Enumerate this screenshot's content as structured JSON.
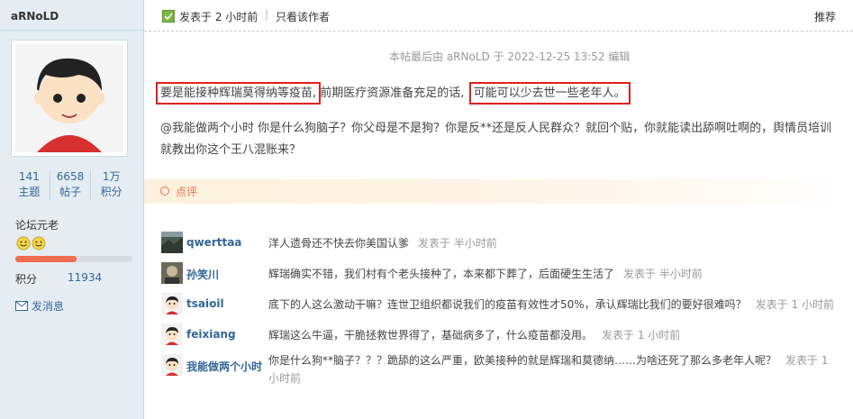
{
  "author": {
    "username": "aRNoLD",
    "stats": [
      {
        "value": "141",
        "label": "主题"
      },
      {
        "value": "6658",
        "label": "帖子"
      },
      {
        "value": "1万",
        "label": "积分"
      }
    ],
    "rank": "论坛元老",
    "progress": 0.52,
    "credits_label": "积分",
    "credits_value": "11934",
    "message_label": "发消息"
  },
  "post": {
    "posted_time": "发表于 2 小时前",
    "separator": "|",
    "only_author": "只看该作者",
    "recommend": "推荐",
    "edited_note": "本帖最后由 aRNoLD 于 2022-12-25 13:52 编辑",
    "para1_part1": "要是能接种辉瑞莫得纳等疫苗,",
    "para1_part2": "前期医疗资源准备充足的话,",
    "para1_part3": "可能可以少去世一些老年人。",
    "para2": "@我能做两个小时 你是什么狗脑子？你父母是不是狗？你是反**还是反人民群众？就回个贴，你就能读出舔啊吐啊的，舆情员培训就教出你这个王八混账来？"
  },
  "rating": {
    "label": "点评"
  },
  "comments": [
    {
      "user": "qwerttaa",
      "text": "洋人遗骨还不快去你美国认爹",
      "time": "发表于 半小时前"
    },
    {
      "user": "孙笑川",
      "text": "辉瑞确实不错，我们村有个老头接种了，本来都下葬了，后面硬生生活了",
      "time": "发表于 半小时前"
    },
    {
      "user": "tsaioil",
      "text": "底下的人这么激动干嘛？连世卫组织都说我们的疫苗有效性才50%，承认辉瑞比我们的要好很难吗？",
      "time": "发表于 1 小时前"
    },
    {
      "user": "feixiang",
      "text": "辉瑞这么牛逼，干脆拯救世界得了，基础病多了，什么疫苗都没用。",
      "time": "发表于 1 小时前"
    },
    {
      "user": "我能做两个小时",
      "text": "你是什么狗**脑子？？？跪舔的这么严重，欧美接种的就是辉瑞和莫德纳……为啥还死了那么多老年人呢？",
      "time": "发表于 1 小时前"
    }
  ],
  "colors": {
    "link": "#336699",
    "accent": "#f26c4f",
    "highlight_box": "#e02020",
    "sidebar_bg": "#e5edf2"
  }
}
